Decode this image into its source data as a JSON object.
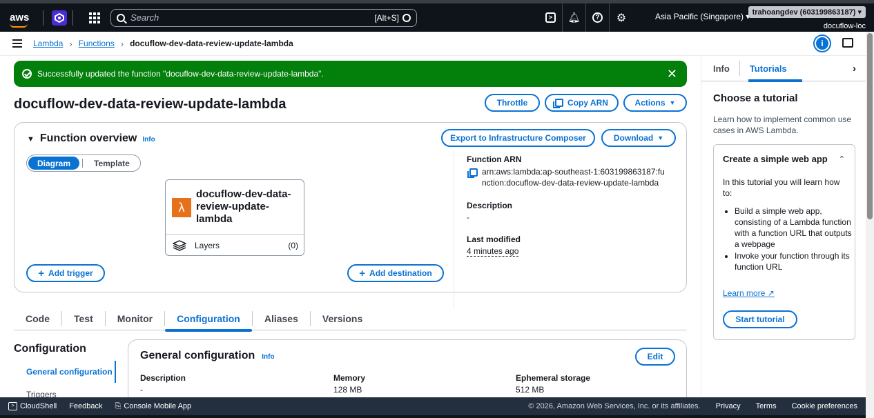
{
  "topnav": {
    "search_placeholder": "Search",
    "search_shortcut": "[Alt+S]",
    "region": "Asia Pacific (Singapore)",
    "account": "trahoangdev (603199863187)",
    "role": "docuflow-loc"
  },
  "breadcrumb": {
    "lambda": "Lambda",
    "functions": "Functions",
    "current": "docuflow-dev-data-review-update-lambda"
  },
  "flash": {
    "message": "Successfully updated the function \"docuflow-dev-data-review-update-lambda\"."
  },
  "page": {
    "title": "docuflow-dev-data-review-update-lambda",
    "throttle": "Throttle",
    "copy_arn": "Copy ARN",
    "actions": "Actions"
  },
  "overview": {
    "title": "Function overview",
    "info": "Info",
    "export": "Export to Infrastructure Composer",
    "download": "Download",
    "seg_diagram": "Diagram",
    "seg_template": "Template",
    "fn_name": "docuflow-dev-data-review-update-lambda",
    "layers_label": "Layers",
    "layers_count": "(0)",
    "add_trigger": "Add trigger",
    "add_destination": "Add destination",
    "arn_label": "Function ARN",
    "arn_value": "arn:aws:lambda:ap-southeast-1:603199863187:function:docuflow-dev-data-review-update-lambda",
    "description_label": "Description",
    "description_value": "-",
    "last_modified_label": "Last modified",
    "last_modified_value": "4 minutes ago"
  },
  "tabs": [
    "Code",
    "Test",
    "Monitor",
    "Configuration",
    "Aliases",
    "Versions"
  ],
  "config": {
    "side_title": "Configuration",
    "side_items": [
      "General configuration",
      "Triggers"
    ],
    "card_title": "General configuration",
    "card_info": "Info",
    "edit": "Edit",
    "cols": [
      {
        "label": "Description",
        "value": "-"
      },
      {
        "label": "Memory",
        "value": "128 MB"
      },
      {
        "label": "Ephemeral storage",
        "value": "512 MB"
      }
    ]
  },
  "tools": {
    "tab_info": "Info",
    "tab_tutorials": "Tutorials",
    "heading": "Choose a tutorial",
    "desc": "Learn how to implement common use cases in AWS Lambda.",
    "card_title": "Create a simple web app",
    "card_intro": "In this tutorial you will learn how to:",
    "bullets": [
      "Build a simple web app, consisting of a Lambda function with a function URL that outputs a webpage",
      "Invoke your function through its function URL"
    ],
    "learn_more": "Learn more",
    "start": "Start tutorial"
  },
  "footer": {
    "cloudshell": "CloudShell",
    "feedback": "Feedback",
    "mobile": "Console Mobile App",
    "copyright": "© 2026, Amazon Web Services, Inc. or its affiliates.",
    "privacy": "Privacy",
    "terms": "Terms",
    "cookies": "Cookie preferences"
  },
  "colors": {
    "accent": "#0972d3",
    "success": "#037f0c",
    "nav": "#0f141a",
    "lambda": "#e7711b"
  }
}
